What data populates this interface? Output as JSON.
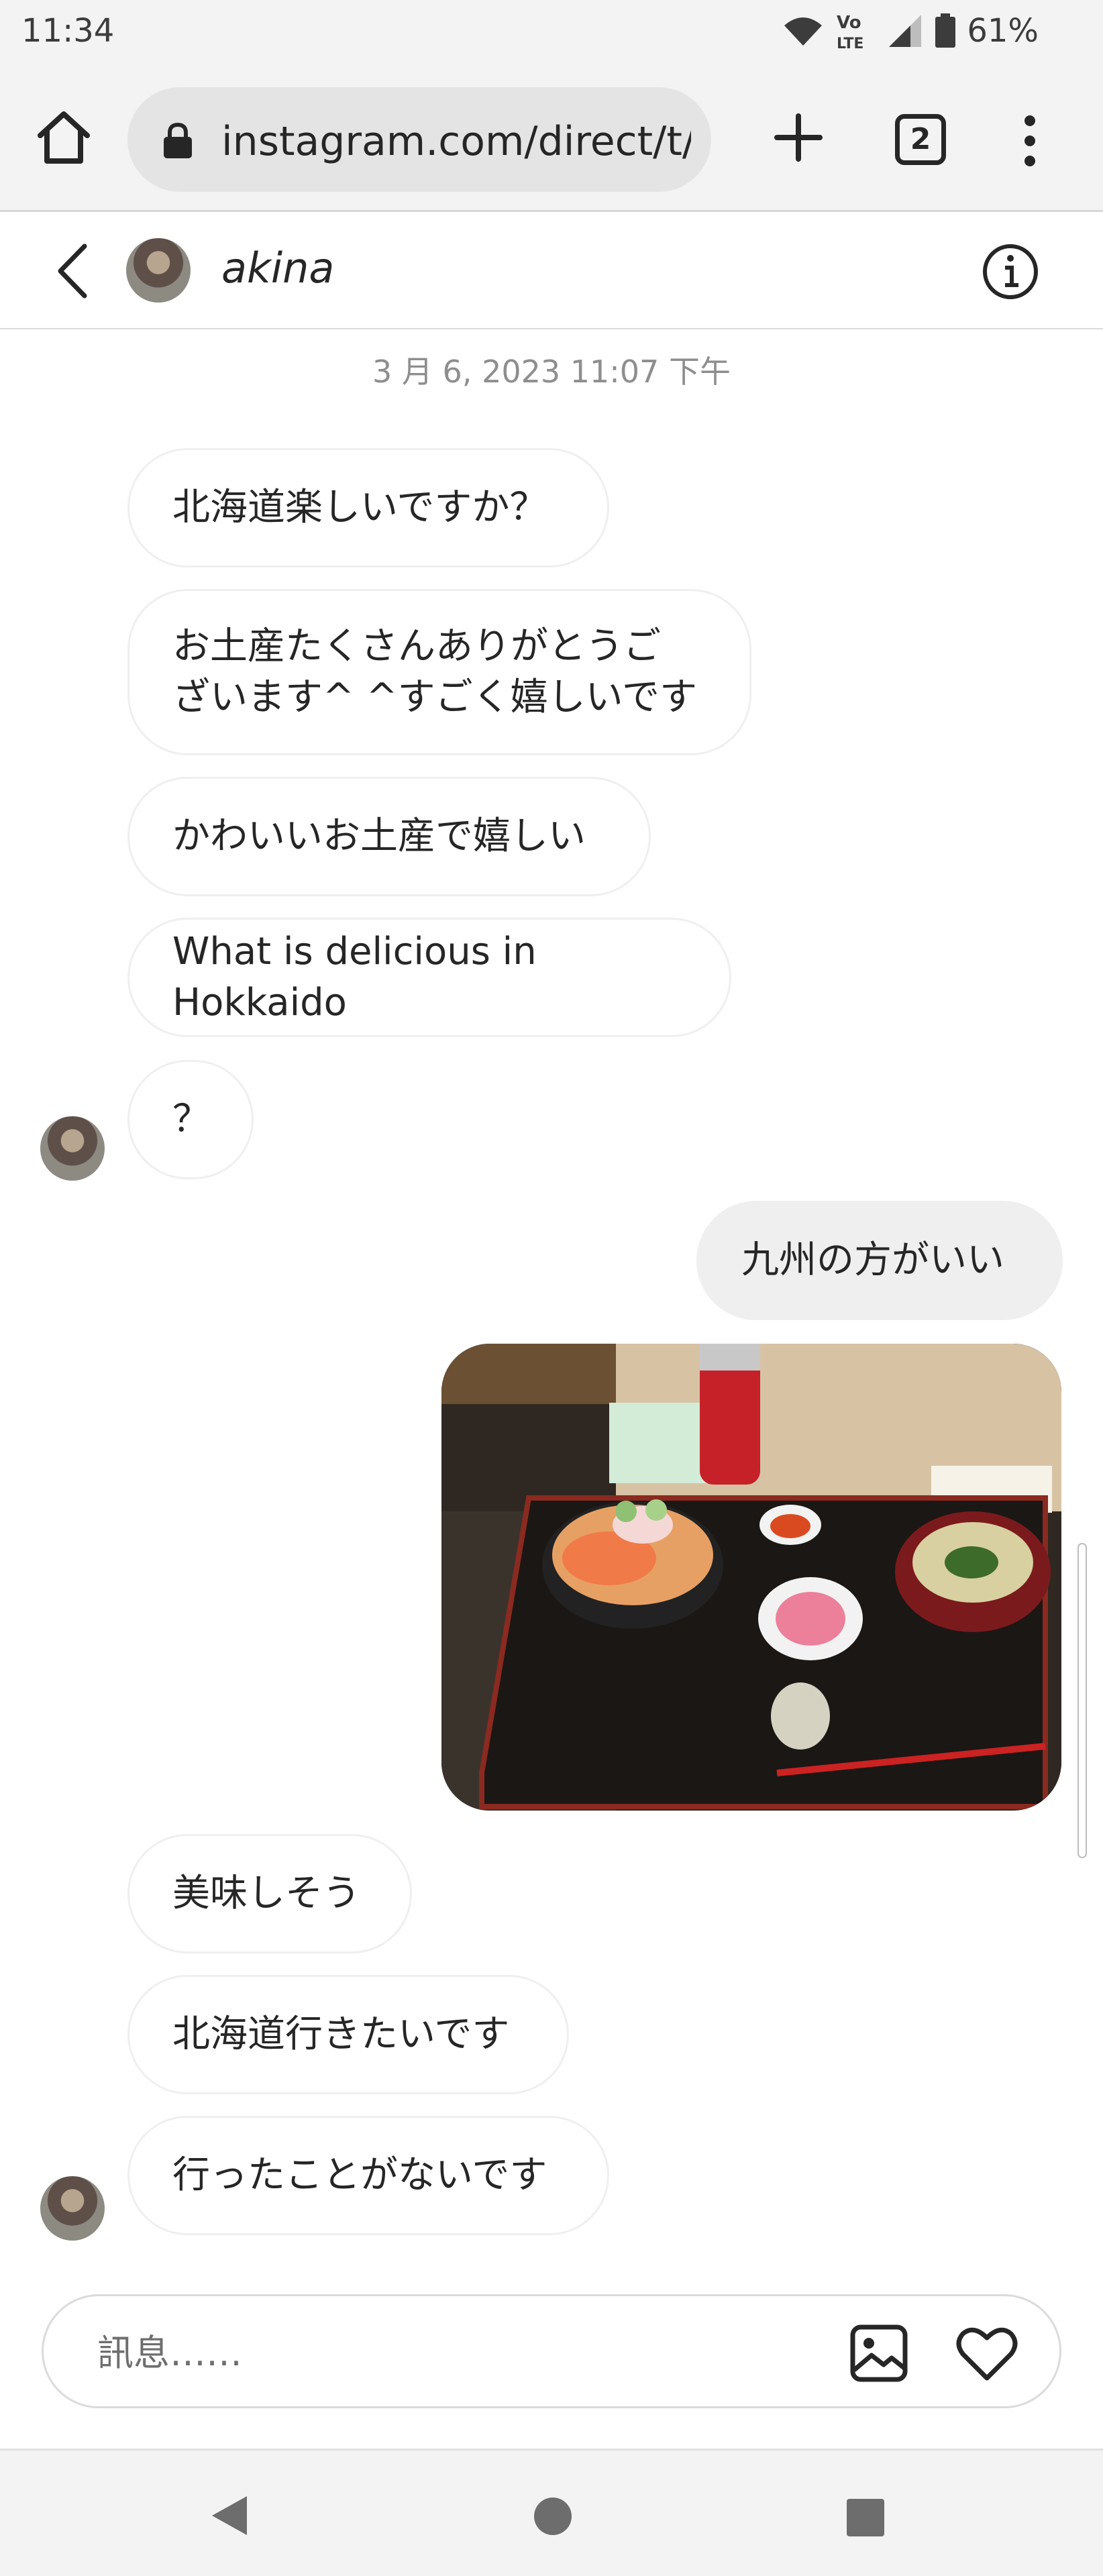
{
  "status_bar": {
    "time": "11:34",
    "battery": "61%",
    "icons": [
      "wifi-icon",
      "volte-icon",
      "signal-icon",
      "battery-icon"
    ]
  },
  "browser": {
    "url": "instagram.com/direct/t/3",
    "tab_count": "2",
    "icons": [
      "home-icon",
      "lock-icon",
      "plus-icon",
      "tabs-icon",
      "menu-icon"
    ]
  },
  "chat_header": {
    "name": "akina",
    "icons": [
      "back-icon",
      "info-icon"
    ]
  },
  "conversation": {
    "timestamp": "3 月 6, 2023 11:07 下午",
    "messages_block_1": [
      "北海道楽しいですか？",
      "お土産たくさんありがとうご\nざいます^ ^すごく嬉しいです",
      "かわいいお土産で嬉しい",
      "What is delicious in Hokkaido",
      "？"
    ],
    "sent_message": "九州の方がいい",
    "photo": "seafood-bowl-meal-photo",
    "messages_block_2": [
      "美味しそう",
      "北海道行きたいです",
      "行ったことがないです"
    ]
  },
  "composer": {
    "placeholder": "訊息……",
    "icons": [
      "image-icon",
      "heart-icon"
    ]
  },
  "colors": {
    "bar_background": "#f3f3f3",
    "bubble_border": "#efefef",
    "sent_bubble": "#efefef",
    "text": "#262626",
    "timestamp": "#8e8e8e"
  }
}
